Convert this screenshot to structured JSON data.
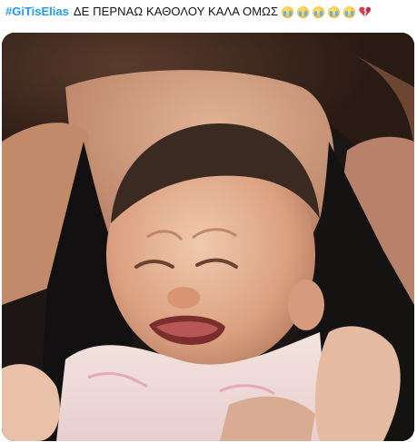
{
  "tweet": {
    "hashtag": "#GiTisElias",
    "text": "ΔΕ ΠΕΡΝΑΩ ΚΑΘΟΛΟΥ ΚΑΛΑ ΟΜΩΣ",
    "emojis": [
      "loudly-crying-face",
      "loudly-crying-face",
      "loudly-crying-face",
      "loudly-crying-face",
      "loudly-crying-face",
      "broken-heart"
    ]
  },
  "colors": {
    "hashtag": "#1d9bf0",
    "text": "#0f1419"
  }
}
